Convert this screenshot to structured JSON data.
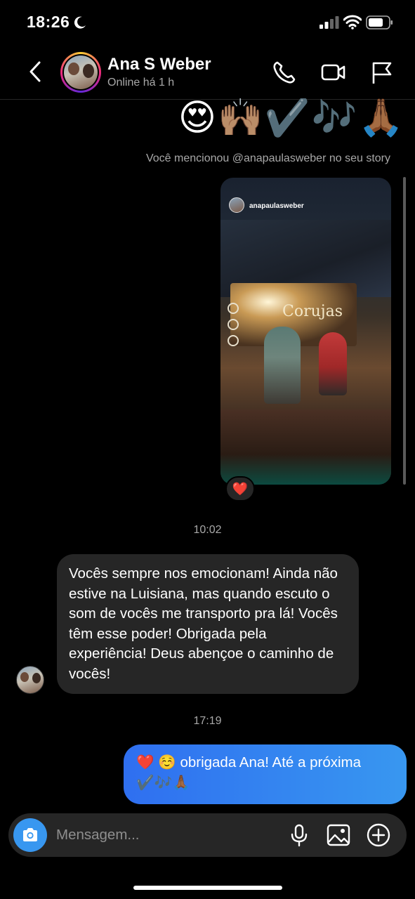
{
  "status_bar": {
    "time": "18:26",
    "icons": [
      "moon-icon",
      "signal-icon",
      "wifi-icon",
      "battery-icon"
    ]
  },
  "header": {
    "contact_name": "Ana S Weber",
    "contact_status": "Online há 1 h",
    "icons": [
      "back-icon",
      "phone-icon",
      "video-icon",
      "flag-icon"
    ]
  },
  "chat": {
    "emoji_row": "😍🙌🏽✔️🎶🙏🏾",
    "mention_note": "Você mencionou @anapaulasweber no seu story",
    "story": {
      "handle": "anapaulasweber",
      "sign_text": "Corujas"
    },
    "story_reaction": "❤️",
    "timestamp_1": "10:02",
    "incoming_message": "Vocês sempre nos emocionam! Ainda não estive na Luisiana, mas quando escuto o som de vocês me transporto pra lá! Vocês têm esse poder! Obrigada pela experiência! Deus abençoe o caminho de vocês!",
    "timestamp_2": "17:19",
    "outgoing_message": "❤️ ☺️ obrigada Ana! Até a próxima ✔️🎶🙏🏾"
  },
  "composer": {
    "placeholder": "Mensagem...",
    "icons": [
      "camera-icon",
      "microphone-icon",
      "gallery-icon",
      "plus-circle-icon"
    ]
  },
  "colors": {
    "background": "#000000",
    "incoming_bubble": "#262626",
    "outgoing_bubble": "#3897f0",
    "secondary_text": "#a8a8a8"
  }
}
